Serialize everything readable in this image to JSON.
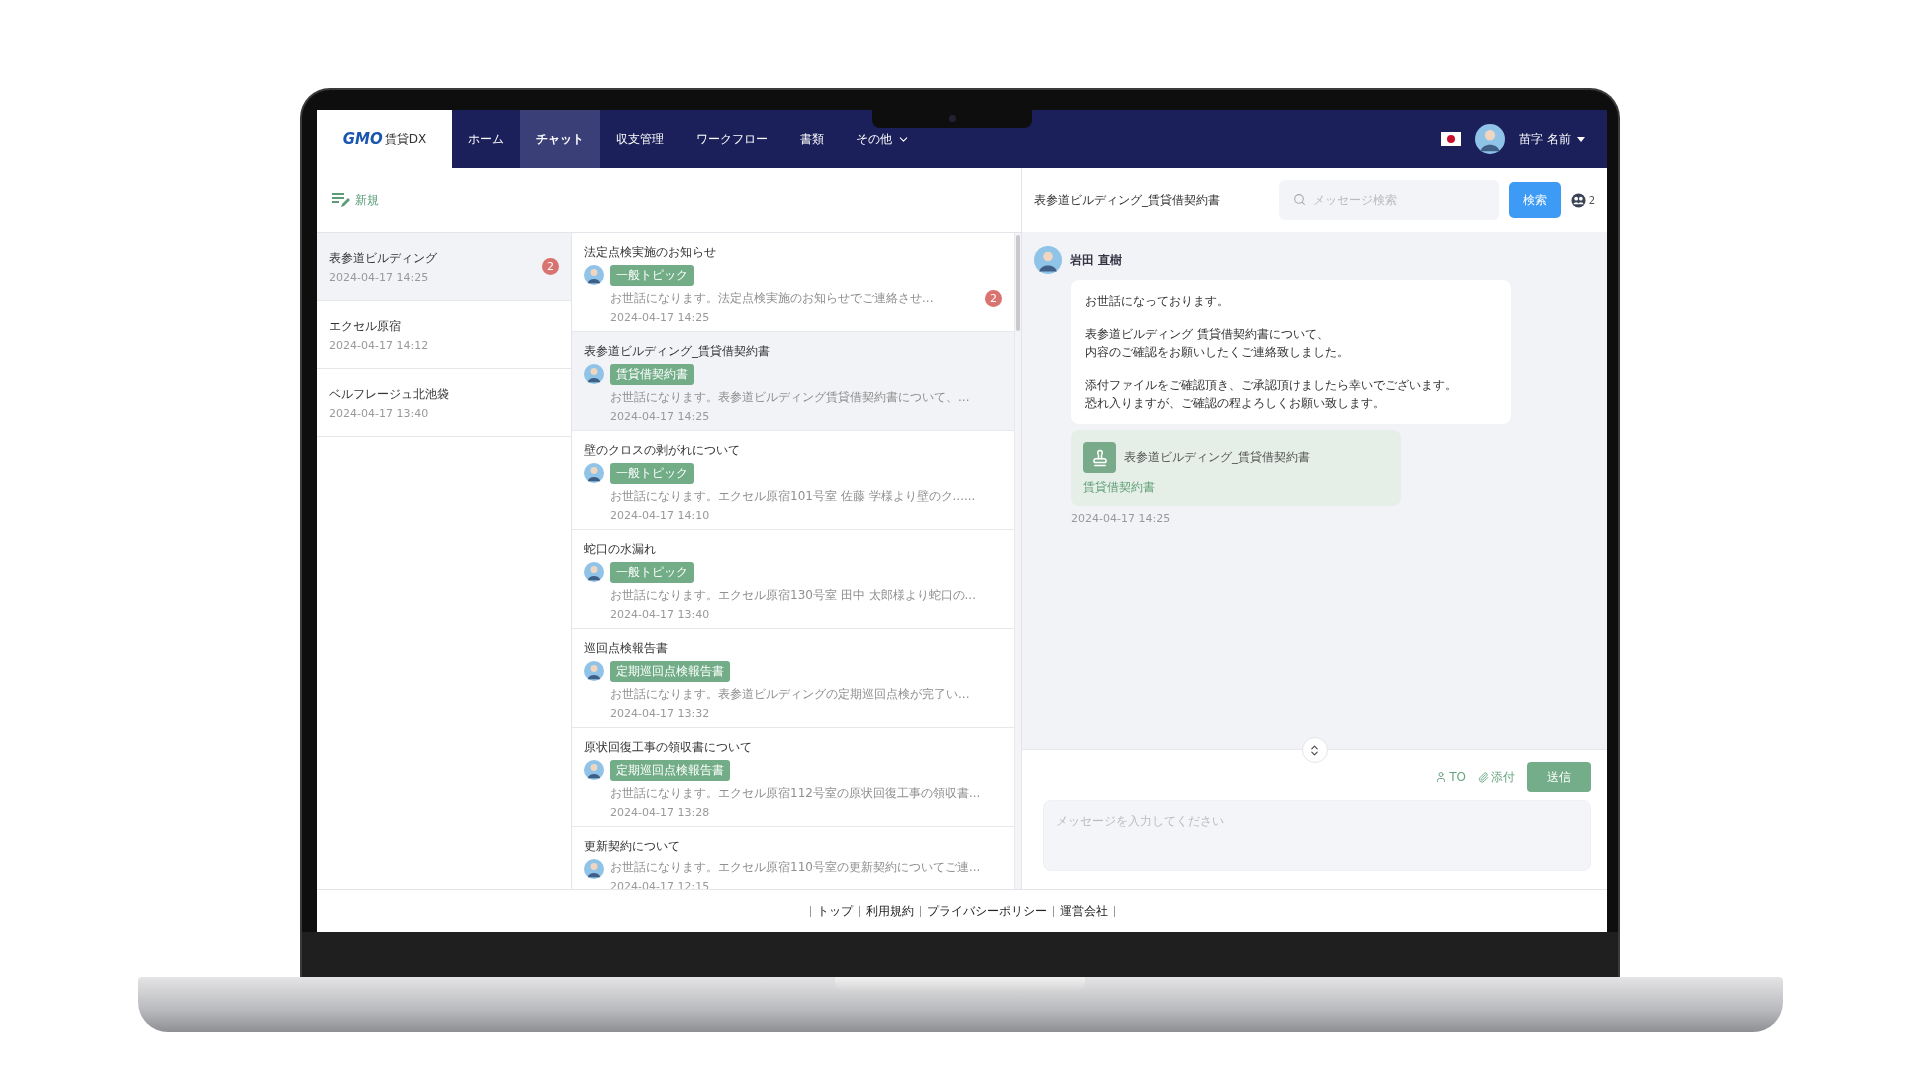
{
  "nav": {
    "logo": {
      "brand": "GMO",
      "product": "賃貸DX"
    },
    "tabs": [
      {
        "label": "ホーム",
        "selected": false
      },
      {
        "label": "チャット",
        "selected": true
      },
      {
        "label": "収支管理",
        "selected": false
      },
      {
        "label": "ワークフロー",
        "selected": false
      },
      {
        "label": "書類",
        "selected": false
      },
      {
        "label": "その他",
        "selected": false,
        "kind": "dropdown"
      }
    ],
    "user_name": "苗字 名前"
  },
  "sidebar": {
    "new_button": "新規",
    "items": [
      {
        "name": "表参道ビルディング",
        "time": "2024-04-17 14:25",
        "badge": "2",
        "selected": true
      },
      {
        "name": "エクセル原宿",
        "time": "2024-04-17 14:12",
        "selected": false
      },
      {
        "name": "ベルフレージュ北池袋",
        "time": "2024-04-17 13:40",
        "selected": false
      }
    ]
  },
  "threads": [
    {
      "title": "法定点検実施のお知らせ",
      "tag": "一般トピック",
      "preview": "お世話になります。法定点検実施のお知らせでご連絡させ...",
      "time": "2024-04-17 14:25",
      "badge": "2",
      "selected": false
    },
    {
      "title": "表参道ビルディング_賃貸借契約書",
      "tag": "賃貸借契約書",
      "preview": "お世話になります。表参道ビルディング賃貸借契約書について、...",
      "time": "2024-04-17 14:25",
      "selected": true
    },
    {
      "title": "壁のクロスの剥がれについて",
      "tag": "一般トピック",
      "preview": "お世話になります。エクセル原宿101号室 佐藤 学様より壁のク......",
      "time": "2024-04-17 14:10",
      "selected": false
    },
    {
      "title": "蛇口の水漏れ",
      "tag": "一般トピック",
      "preview": "お世話になります。エクセル原宿130号室 田中 太郎様より蛇口の...",
      "time": "2024-04-17 13:40",
      "selected": false
    },
    {
      "title": "巡回点検報告書",
      "tag": "定期巡回点検報告書",
      "preview": "お世話になります。表参道ビルディングの定期巡回点検が完了い...",
      "time": "2024-04-17 13:32",
      "selected": false
    },
    {
      "title": "原状回復工事の領収書について",
      "tag": "定期巡回点検報告書",
      "preview": "お世話になります。エクセル原宿112号室の原状回復工事の領収書...",
      "time": "2024-04-17 13:28",
      "selected": false
    },
    {
      "title": "更新契約について",
      "preview": "お世話になります。エクセル原宿110号室の更新契約についてご連...",
      "time": "2024-04-17 12:15",
      "selected": false
    }
  ],
  "chat": {
    "title": "表参道ビルディング_賃貸借契約書",
    "search": {
      "placeholder": "メッセージ検索",
      "button": "検索"
    },
    "member_count": "2",
    "messages": [
      {
        "sender": "岩田 直樹",
        "paragraphs": [
          [
            "お世話になっております。"
          ],
          [
            "表参道ビルディング 賃貸借契約書について、",
            "内容のご確認をお願いしたくご連絡致しました。"
          ],
          [
            "添付ファイルをご確認頂き、ご承認頂けましたら幸いでございます。",
            "恐れ入りますが、ご確認の程よろしくお願い致します。"
          ]
        ],
        "attachment": {
          "name": "表参道ビルディング_賃貸借契約書",
          "category": "賃貸借契約書"
        },
        "time": "2024-04-17 14:25"
      }
    ]
  },
  "composer": {
    "to": "TO",
    "attach": "添付",
    "send": "送信",
    "placeholder": "メッセージを入力してください"
  },
  "footer": {
    "links": [
      "トップ",
      "利用規約",
      "プライバシーポリシー",
      "運営会社"
    ]
  }
}
